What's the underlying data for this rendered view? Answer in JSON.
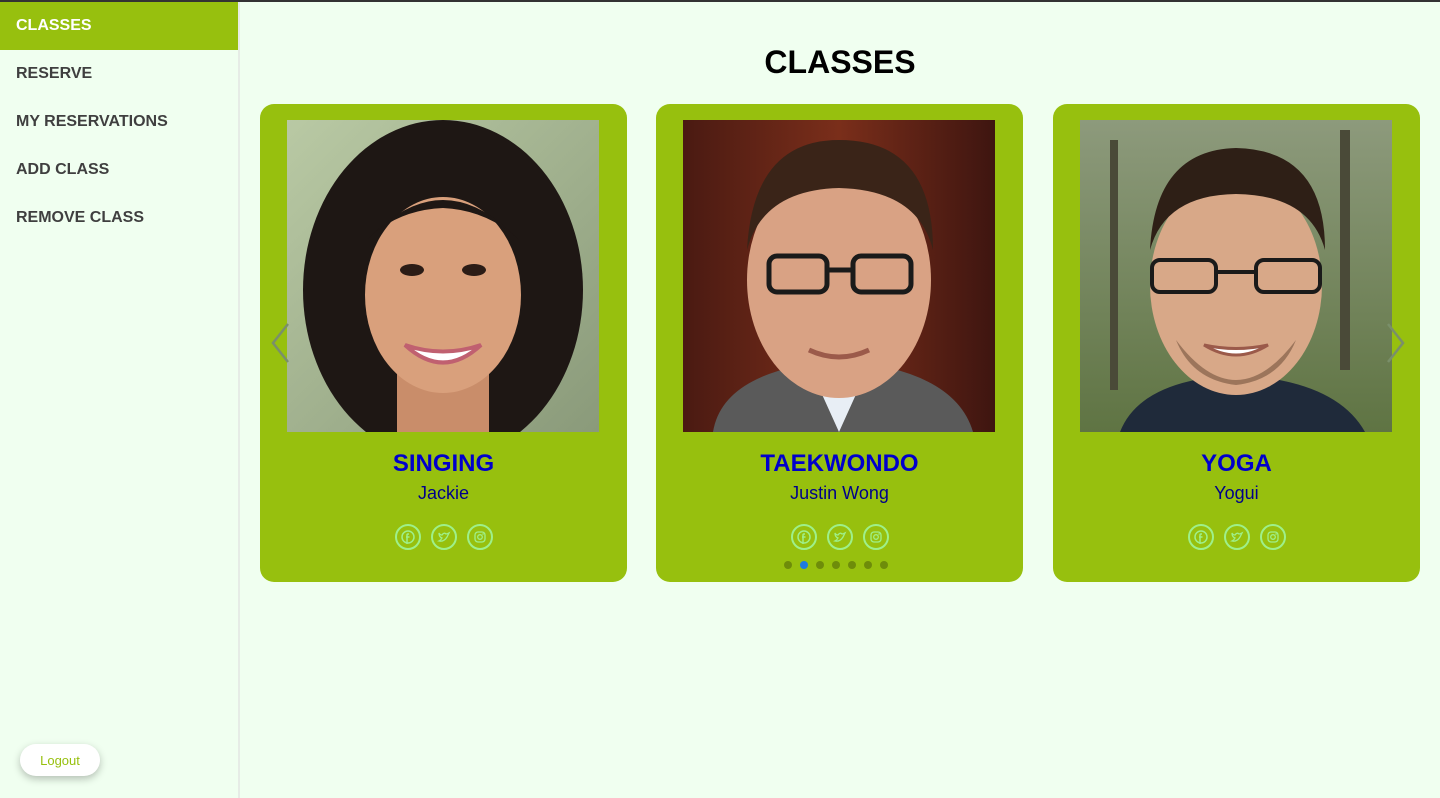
{
  "sidebar": {
    "items": [
      {
        "label": "CLASSES",
        "active": true
      },
      {
        "label": "RESERVE"
      },
      {
        "label": "MY RESERVATIONS"
      },
      {
        "label": "ADD CLASS"
      },
      {
        "label": "REMOVE CLASS"
      }
    ],
    "logout_label": "Logout"
  },
  "main": {
    "title": "CLASSES",
    "cards": [
      {
        "name": "SINGING",
        "teacher": "Jackie"
      },
      {
        "name": "TAEKWONDO",
        "teacher": "Justin Wong"
      },
      {
        "name": "YOGA",
        "teacher": "Yogui"
      }
    ],
    "social_icons": [
      "facebook-icon",
      "twitter-icon",
      "instagram-icon"
    ],
    "carousel": {
      "total_slides": 7,
      "active_index": 1
    }
  },
  "colors": {
    "accent": "#97c00e",
    "background": "#f0fff0",
    "card_title": "#0000cc",
    "card_teacher": "#00008b",
    "dot_active": "#1f7ae0"
  }
}
